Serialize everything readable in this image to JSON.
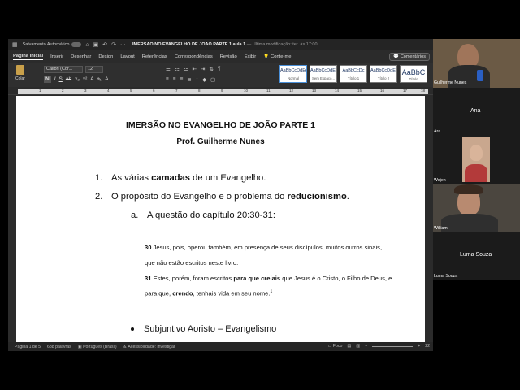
{
  "titlebar": {
    "autosave_label": "Salvamento Automático",
    "doc_title": "IMERSÃO NO EVANGELHO DE JOÃO PARTE 1 aula 1",
    "last_modified": "— Última modificação: ter. às 17:00"
  },
  "tabs": [
    "Página Inicial",
    "Inserir",
    "Desenhar",
    "Design",
    "Layout",
    "Referências",
    "Correspondências",
    "Revisão",
    "Exibir",
    "Conte-me"
  ],
  "comments_label": "Comentários",
  "ribbon": {
    "paste_label": "Colar",
    "font_name": "Calibri (Cor...",
    "font_size": "12",
    "styles": [
      {
        "preview": "AaBbCcDdEe",
        "name": "Normal"
      },
      {
        "preview": "AaBbCcDdEe",
        "name": "Sem Espaço..."
      },
      {
        "preview": "AaBbCcDc",
        "name": "Título 1"
      },
      {
        "preview": "AaBbCcDdEe",
        "name": "Título 2"
      },
      {
        "preview": "AaBbC",
        "name": "Título"
      }
    ]
  },
  "ruler": [
    "1",
    "2",
    "3",
    "4",
    "5",
    "6",
    "7",
    "8",
    "9",
    "10",
    "11",
    "12",
    "13",
    "14",
    "15",
    "16",
    "17",
    "18"
  ],
  "document": {
    "title": "IMERSÃO NO EVANGELHO DE JOÃO PARTE 1",
    "author": "Prof. Guilherme Nunes",
    "item1": {
      "num": "1.",
      "pre": "As várias ",
      "bold": "camadas",
      "post": " de um Evangelho."
    },
    "item2": {
      "num": "2.",
      "pre": "O propósito do Evangelho e o problema do ",
      "bold": "reducionismo",
      "post": "."
    },
    "subitem_a": {
      "letter": "a.",
      "text": "A questão do capítulo 20:30-31:"
    },
    "verse30": {
      "num": "30",
      "line1": " Jesus, pois, operou também, em presença de seus discípulos, muitos outros sinais,",
      "line2": "que não estão escritos neste livro."
    },
    "verse31": {
      "num": "31",
      "pre": " Estes, porém, foram escritos ",
      "bold1": "para que creiais",
      "mid": " que Jesus é o Cristo, o Filho de Deus, e",
      "line2_pre": "para que, ",
      "bold2": "crendo",
      "line2_post": ", tenhais vida em seu nome.",
      "footnote": "1"
    },
    "bullet": "Subjuntivo Aoristo – Evangelismo"
  },
  "statusbar": {
    "page": "Página 1 de 5",
    "words": "688 palavras",
    "language": "Português (Brasil)",
    "accessibility": "Acessibilidade: investigar",
    "focus": "Foco",
    "zoom": "22"
  },
  "participants": [
    {
      "name": "Guilherme Nunes"
    },
    {
      "name": "Ana"
    },
    {
      "name": "Ara"
    },
    {
      "name": "Wejen"
    },
    {
      "name": "William"
    },
    {
      "name": "Luma Souza"
    },
    {
      "name": "Luma Souza"
    }
  ]
}
